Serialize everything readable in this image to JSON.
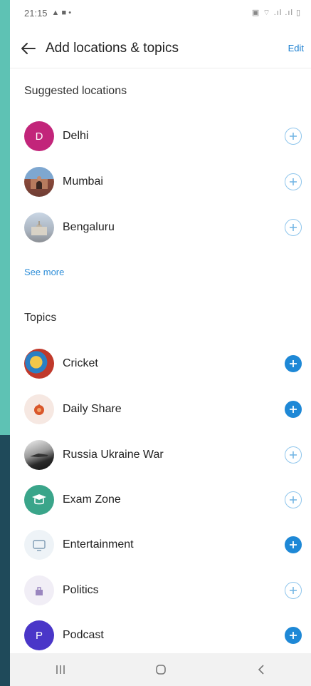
{
  "status_bar": {
    "time": "21:15",
    "indicators": "▲ ■ •",
    "right_icons": "▣ ⌔ .ıl .ıl ▯"
  },
  "header": {
    "title": "Add locations & topics",
    "edit_label": "Edit"
  },
  "suggested_locations": {
    "heading": "Suggested locations",
    "items": [
      {
        "label": "Delhi",
        "avatar_letter": "D",
        "avatar_color": "#c2257a",
        "state": "add"
      },
      {
        "label": "Mumbai",
        "avatar_letter": "",
        "avatar_color": "#8a6a5a",
        "state": "add"
      },
      {
        "label": "Bengaluru",
        "avatar_letter": "",
        "avatar_color": "#a9b3bf",
        "state": "add"
      }
    ],
    "see_more": "See more"
  },
  "topics": {
    "heading": "Topics",
    "items": [
      {
        "label": "Cricket",
        "avatar_letter": "",
        "avatar_color": "#c0392b",
        "state": "added"
      },
      {
        "label": "Daily Share",
        "avatar_letter": "",
        "avatar_color": "#f6e8e2",
        "state": "added"
      },
      {
        "label": "Russia Ukraine War",
        "avatar_letter": "",
        "avatar_color": "#3a3a3a",
        "state": "add"
      },
      {
        "label": "Exam Zone",
        "avatar_letter": "",
        "avatar_color": "#3aa58a",
        "state": "add"
      },
      {
        "label": "Entertainment",
        "avatar_letter": "",
        "avatar_color": "#eef3f7",
        "state": "added"
      },
      {
        "label": "Politics",
        "avatar_letter": "",
        "avatar_color": "#f1eef6",
        "state": "add"
      },
      {
        "label": "Podcast",
        "avatar_letter": "P",
        "avatar_color": "#4a36c8",
        "state": "added"
      }
    ]
  },
  "colors": {
    "accent": "#1e88d6",
    "outline_plus": "#8ec5ec"
  },
  "nav_bar": {
    "recents_icon": "recents-icon",
    "home_icon": "home-icon",
    "back_icon": "back-icon"
  }
}
